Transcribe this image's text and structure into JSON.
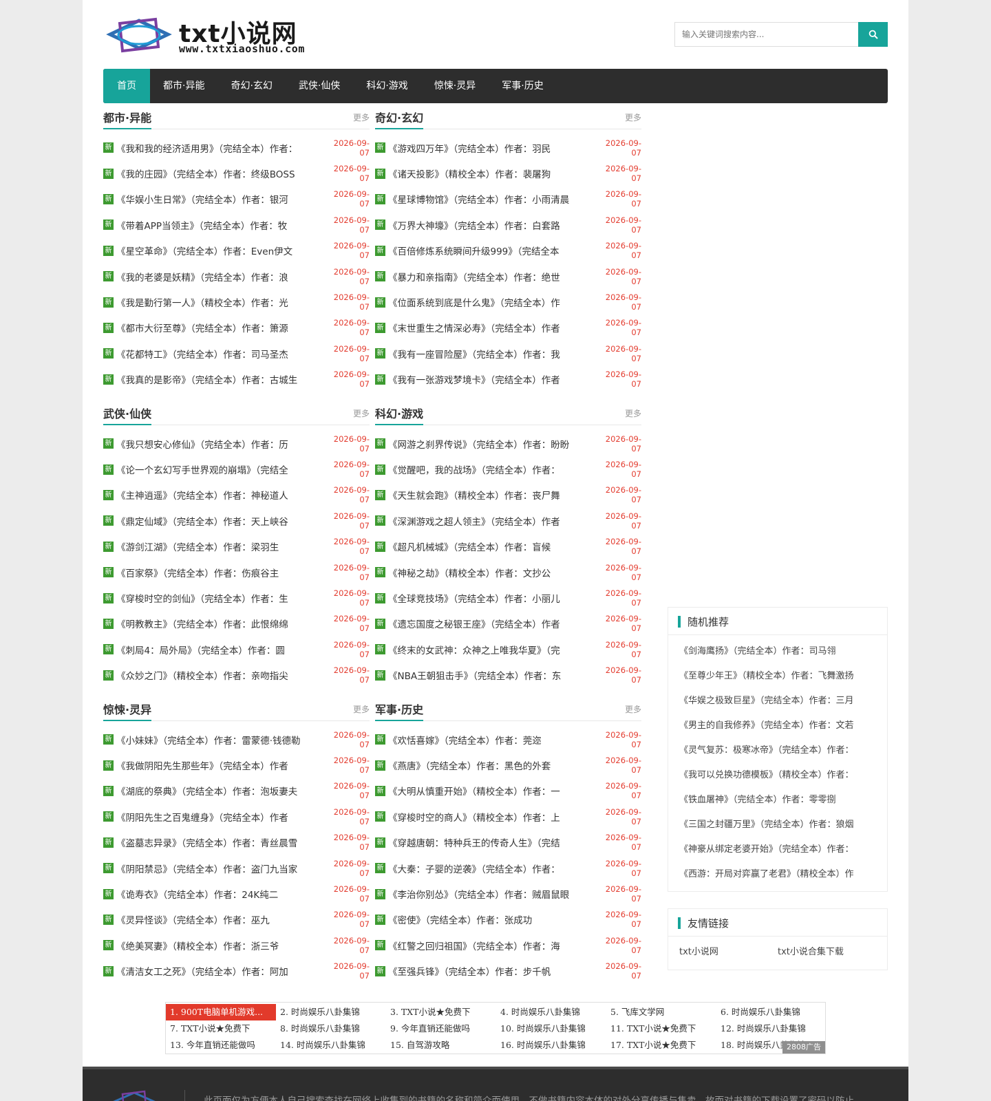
{
  "header": {
    "logo_name": "txt小说网",
    "logo_url": "www.txtxiaoshuo.com",
    "search_placeholder": "输入关键词搜索内容..."
  },
  "nav": [
    "首页",
    "都市·异能",
    "奇幻·玄幻",
    "武侠·仙侠",
    "科幻·游戏",
    "惊悚·灵异",
    "军事·历史"
  ],
  "badge": "新",
  "more_label": "更多",
  "sections": [
    {
      "title": "都市·异能",
      "items": [
        {
          "text": "《我和我的经济适用男》（完结全本）作者：",
          "date": "2026-09-07"
        },
        {
          "text": "《我的庄园》（完结全本）作者：终级BOSS",
          "date": "2026-09-07"
        },
        {
          "text": "《华娱小生日常》（完结全本）作者：银河",
          "date": "2026-09-07"
        },
        {
          "text": "《带着APP当领主》（完结全本）作者：牧",
          "date": "2026-09-07"
        },
        {
          "text": "《星空革命》（完结全本）作者：Even伊文",
          "date": "2026-09-07"
        },
        {
          "text": "《我的老婆是妖精》（完结全本）作者：浪",
          "date": "2026-09-07"
        },
        {
          "text": "《我是勤行第一人》（精校全本）作者：光",
          "date": "2026-09-07"
        },
        {
          "text": "《都市大衍至尊》（完结全本）作者：箫源",
          "date": "2026-09-07"
        },
        {
          "text": "《花都特工》（完结全本）作者：司马圣杰",
          "date": "2026-09-07"
        },
        {
          "text": "《我真的是影帝》（完结全本）作者：古城生",
          "date": "2026-09-07"
        }
      ]
    },
    {
      "title": "奇幻·玄幻",
      "items": [
        {
          "text": "《游戏四万年》（完结全本）作者：羽民",
          "date": "2026-09-07"
        },
        {
          "text": "《诸天投影》（精校全本）作者：裴屠狗",
          "date": "2026-09-07"
        },
        {
          "text": "《星球博物馆》（完结全本）作者：小雨清晨",
          "date": "2026-09-07"
        },
        {
          "text": "《万界大神壕》（完结全本）作者：白套路",
          "date": "2026-09-07"
        },
        {
          "text": "《百倍修炼系统瞬间升级999》（完结全本",
          "date": "2026-09-07"
        },
        {
          "text": "《暴力和亲指南》（完结全本）作者：绝世",
          "date": "2026-09-07"
        },
        {
          "text": "《位面系统到底是什么鬼》（完结全本）作",
          "date": "2026-09-07"
        },
        {
          "text": "《末世重生之情深必寿》（完结全本）作者",
          "date": "2026-09-07"
        },
        {
          "text": "《我有一座冒险屋》（完结全本）作者：我",
          "date": "2026-09-07"
        },
        {
          "text": "《我有一张游戏梦境卡》（完结全本）作者",
          "date": "2026-09-07"
        }
      ]
    },
    {
      "title": "武侠·仙侠",
      "items": [
        {
          "text": "《我只想安心修仙》（完结全本）作者：历",
          "date": "2026-09-07"
        },
        {
          "text": "《论一个玄幻写手世界观的崩塌》（完结全",
          "date": "2026-09-07"
        },
        {
          "text": "《主神逍遥》（完结全本）作者：神秘道人",
          "date": "2026-09-07"
        },
        {
          "text": "《鼎定仙域》（完结全本）作者：天上峡谷",
          "date": "2026-09-07"
        },
        {
          "text": "《游剑江湖》（完结全本）作者：梁羽生",
          "date": "2026-09-07"
        },
        {
          "text": "《百家祭》（完结全本）作者：伤痕谷主",
          "date": "2026-09-07"
        },
        {
          "text": "《穿梭时空的剑仙》（完结全本）作者：生",
          "date": "2026-09-07"
        },
        {
          "text": "《明教教主》（完结全本）作者：此恨绵绵",
          "date": "2026-09-07"
        },
        {
          "text": "《刺局4：局外局》（完结全本）作者：圆",
          "date": "2026-09-07"
        },
        {
          "text": "《众妙之门》（精校全本）作者：亲吻指尖",
          "date": "2026-09-07"
        }
      ]
    },
    {
      "title": "科幻·游戏",
      "items": [
        {
          "text": "《网游之刹界传说》（完结全本）作者：盼盼",
          "date": "2026-09-07"
        },
        {
          "text": "《觉醒吧，我的战场》（完结全本）作者：",
          "date": "2026-09-07"
        },
        {
          "text": "《天生就会跑》（精校全本）作者：丧尸舞",
          "date": "2026-09-07"
        },
        {
          "text": "《深渊游戏之超人领主》（完结全本）作者",
          "date": "2026-09-07"
        },
        {
          "text": "《超凡机械城》（完结全本）作者：盲候",
          "date": "2026-09-07"
        },
        {
          "text": "《神秘之劫》（精校全本）作者：文抄公",
          "date": "2026-09-07"
        },
        {
          "text": "《全球竞技场》（完结全本）作者：小丽儿",
          "date": "2026-09-07"
        },
        {
          "text": "《遗忘国度之秘银王座》（完结全本）作者",
          "date": "2026-09-07"
        },
        {
          "text": "《终末的女武神：众神之上唯我华夏》（完",
          "date": "2026-09-07"
        },
        {
          "text": "《NBA王朝狙击手》（完结全本）作者：东",
          "date": "2026-09-07"
        }
      ]
    },
    {
      "title": "惊悚·灵异",
      "items": [
        {
          "text": "《小妹妹》（完结全本）作者：雷蒙德·钱德勒",
          "date": "2026-09-07"
        },
        {
          "text": "《我做阴阳先生那些年》（完结全本）作者",
          "date": "2026-09-07"
        },
        {
          "text": "《湖底的祭典》（完结全本）作者：泡坂妻夫",
          "date": "2026-09-07"
        },
        {
          "text": "《阴阳先生之百鬼缠身》（完结全本）作者",
          "date": "2026-09-07"
        },
        {
          "text": "《盗墓志异录》（完结全本）作者：青丝晨雪",
          "date": "2026-09-07"
        },
        {
          "text": "《阴阳禁忌》（完结全本）作者：盗门九当家",
          "date": "2026-09-07"
        },
        {
          "text": "《诡寿衣》（完结全本）作者：24K纯二",
          "date": "2026-09-07"
        },
        {
          "text": "《灵异怪谈》（完结全本）作者：巫九",
          "date": "2026-09-07"
        },
        {
          "text": "《绝美冥妻》（精校全本）作者：浙三爷",
          "date": "2026-09-07"
        },
        {
          "text": "《清洁女工之死》（完结全本）作者：阿加",
          "date": "2026-09-07"
        }
      ]
    },
    {
      "title": "军事·历史",
      "items": [
        {
          "text": "《欢恬喜嫁》（完结全本）作者：莞迩",
          "date": "2026-09-07"
        },
        {
          "text": "《燕唐》（完结全本）作者：黑色的外套",
          "date": "2026-09-07"
        },
        {
          "text": "《大明从慎重开始》（精校全本）作者：一",
          "date": "2026-09-07"
        },
        {
          "text": "《穿梭时空的商人》（精校全本）作者：上",
          "date": "2026-09-07"
        },
        {
          "text": "《穿越唐朝：特种兵王的传奇人生》（完结",
          "date": "2026-09-07"
        },
        {
          "text": "《大秦：子婴的逆袭》（完结全本）作者：",
          "date": "2026-09-07"
        },
        {
          "text": "《李治你别怂》（完结全本）作者：贼眉鼠眼",
          "date": "2026-09-07"
        },
        {
          "text": "《密使》（完结全本）作者：张成功",
          "date": "2026-09-07"
        },
        {
          "text": "《红警之回归祖国》（完结全本）作者：海",
          "date": "2026-09-07"
        },
        {
          "text": "《至强兵锋》（完结全本）作者：步千帆",
          "date": "2026-09-07"
        }
      ]
    }
  ],
  "sidebar": {
    "random_title": "随机推荐",
    "random_items": [
      "《剑海鹰扬》（完结全本）作者：司马翎",
      "《至尊少年王》（精校全本）作者：飞舞激扬",
      "《华娱之极致巨星》（完结全本）作者：三月",
      "《男主的自我修养》（完结全本）作者：文若",
      "《灵气复苏：极寒冰帝》（完结全本）作者：",
      "《我可以兑换功德模板》（精校全本）作者：",
      "《铁血屠神》（完结全本）作者：零零捌",
      "《三国之封疆万里》（完结全本）作者：狼烟",
      "《神豪从绑定老婆开始》（完结全本）作者：",
      "《西游：开局对弈赢了老君》（精校全本）作"
    ],
    "links_title": "友情链接",
    "links": [
      "txt小说网",
      "txt小说合集下载"
    ]
  },
  "ad": {
    "items": [
      "1. 900T电脑单机游戏...",
      "2. 时尚娱乐八卦集锦",
      "3. TXT小说★免费下",
      "4. 时尚娱乐八卦集锦",
      "5. 飞库文学网",
      "6. 时尚娱乐八卦集锦",
      "7. TXT小说★免费下",
      "8. 时尚娱乐八卦集锦",
      "9. 今年直销还能做吗",
      "10. 时尚娱乐八卦集锦",
      "11. TXT小说★免费下",
      "12. 时尚娱乐八卦集锦",
      "13. 今年直销还能做吗",
      "14. 时尚娱乐八卦集锦",
      "15. 自驾游攻略",
      "16. 时尚娱乐八卦集锦",
      "17. TXT小说★免费下",
      "18. 时尚娱乐八卦集锦"
    ],
    "tag": "2808广告"
  },
  "footer": {
    "text": "此页面仅为方便本人自己搜索查找在网络上收集到的书籍的名称和简介而使用，不做书籍内容本体的对外分享传播与售卖，故而对书籍的下载设置了密码以防止"
  },
  "colors": {
    "accent": "#17a49a",
    "nav_bg": "#2d2d2d",
    "date": "#e33b2e",
    "badge": "#3d9a30",
    "ad_highlight": "#e23a2b"
  }
}
